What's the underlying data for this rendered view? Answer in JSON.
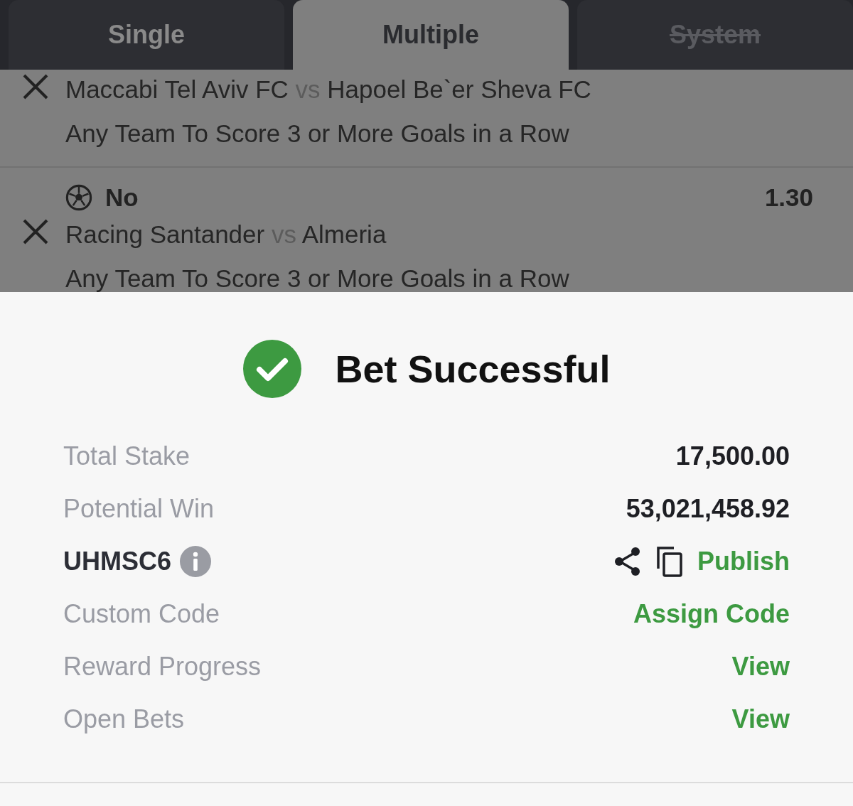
{
  "tabs": [
    {
      "label": "Single",
      "selected": false,
      "disabled": false
    },
    {
      "label": "Multiple",
      "selected": true,
      "disabled": false
    },
    {
      "label": "System",
      "selected": false,
      "disabled": true
    }
  ],
  "legs": [
    {
      "home": "Maccabi Tel Aviv FC",
      "vs": "vs",
      "away": "Hapoel Be`er Sheva FC",
      "market": "Any Team To Score 3 or More Goals in a Row"
    },
    {
      "pick": "No",
      "odds": "1.30",
      "home": "Racing Santander",
      "vs": "vs",
      "away": "Almeria",
      "market": "Any Team To Score 3 or More Goals in a Row"
    }
  ],
  "result": {
    "title": "Bet Successful",
    "rows": [
      {
        "kind": "value",
        "label": "Total Stake",
        "value": "17,500.00"
      },
      {
        "kind": "value",
        "label": "Potential Win",
        "value": "53,021,458.92"
      },
      {
        "kind": "code",
        "label": "UHMSC6",
        "link": "Publish"
      },
      {
        "kind": "link",
        "label": "Custom Code",
        "link": "Assign Code"
      },
      {
        "kind": "link",
        "label": "Reward Progress",
        "link": "View"
      },
      {
        "kind": "link",
        "label": "Open Bets",
        "link": "View"
      }
    ]
  }
}
